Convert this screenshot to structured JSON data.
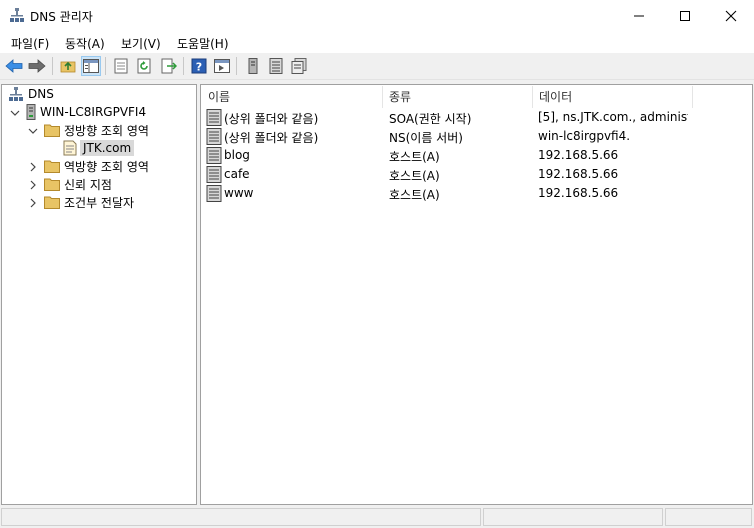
{
  "window": {
    "title": "DNS 관리자"
  },
  "menu": [
    "파일(F)",
    "동작(A)",
    "보기(V)",
    "도움말(H)"
  ],
  "tree": {
    "root": "DNS",
    "server": "WIN-LC8IRGPVFI4",
    "forward_zones": "정방향 조회 영역",
    "zone": "JTK.com",
    "reverse_zones": "역방향 조회 영역",
    "trust_points": "신뢰 지점",
    "conditional_forwarders": "조건부 전달자"
  },
  "list": {
    "headers": [
      "이름",
      "종류",
      "데이터"
    ],
    "rows": [
      {
        "name": "(상위 폴더와 같음)",
        "type": "SOA(권한 시작)",
        "data": "[5], ns.JTK.com., administ…"
      },
      {
        "name": "(상위 폴더와 같음)",
        "type": "NS(이름 서버)",
        "data": "win-lc8irgpvfi4."
      },
      {
        "name": "blog",
        "type": "호스트(A)",
        "data": "192.168.5.66"
      },
      {
        "name": "cafe",
        "type": "호스트(A)",
        "data": "192.168.5.66"
      },
      {
        "name": "www",
        "type": "호스트(A)",
        "data": "192.168.5.66"
      }
    ]
  },
  "colors": {
    "accent": "#0078d7",
    "folder": "#e8c465",
    "selection": "#d9d9d9"
  },
  "icons": [
    "dns-icon",
    "server-icon",
    "folder-icon",
    "zone-icon",
    "record-icon",
    "back-icon",
    "forward-icon",
    "up-folder-icon",
    "show-tree-icon",
    "help-icon"
  ]
}
